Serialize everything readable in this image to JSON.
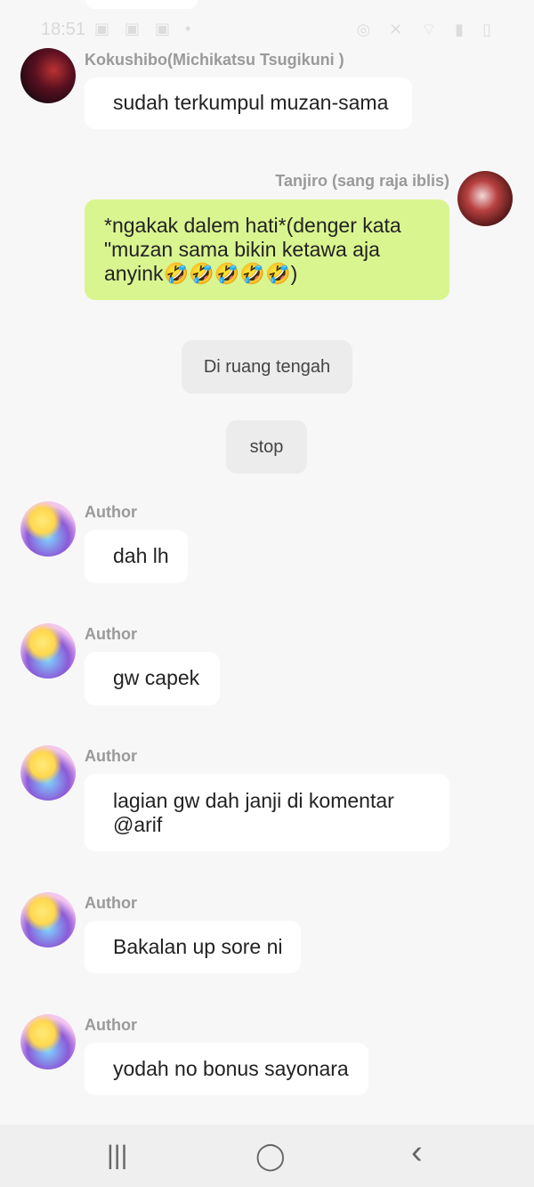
{
  "status": {
    "time": "18:51",
    "left_icons": "▣ ▣ ▣ •",
    "right_icons": "◎ ✕ ⌔ ▮ ▯"
  },
  "messages": [
    {
      "sender": "Kokushibo(Michikatsu Tsugikuni )",
      "text": "sudah terkumpul muzan-sama"
    },
    {
      "sender": "Tanjiro (sang raja iblis)",
      "text": "*ngakak dalem hati*(denger kata \"muzan sama bikin ketawa aja anyink🤣🤣🤣🤣🤣)"
    },
    {
      "text": "Di ruang tengah"
    },
    {
      "text": "stop"
    },
    {
      "sender": "Author",
      "text": "dah lh"
    },
    {
      "sender": "Author",
      "text": "gw capek"
    },
    {
      "sender": "Author",
      "text": "lagian gw dah janji di komentar @arif"
    },
    {
      "sender": "Author",
      "text": "Bakalan up sore ni"
    },
    {
      "sender": "Author",
      "text": "yodah no bonus sayonara"
    }
  ],
  "nav": {
    "recents": "|||",
    "home": "◯",
    "back": "‹"
  },
  "colors": {
    "own_bubble": "#d9f590",
    "other_bubble": "#ffffff",
    "background": "#f7f7f7"
  }
}
